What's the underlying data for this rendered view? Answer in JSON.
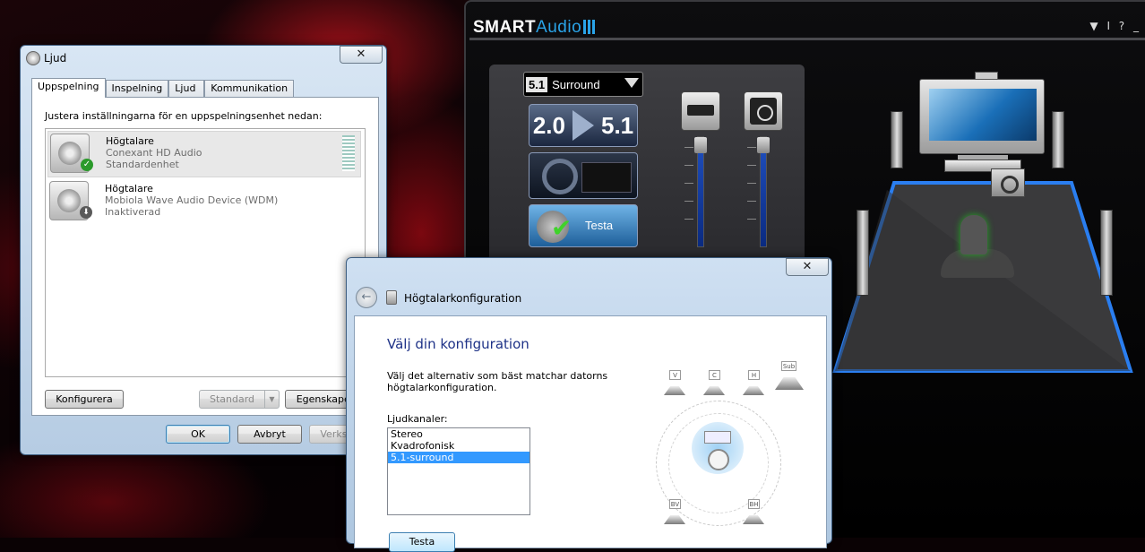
{
  "smart_audio": {
    "brand_smart": "SMART",
    "brand_audio": "Audio",
    "window_controls": "▼ I ? _",
    "mode_badge": "5.1",
    "mode_label": "Surround",
    "tile_from": "2.0",
    "tile_to": "5.1",
    "test_label": "Testa"
  },
  "ljud": {
    "title": "Ljud",
    "close": "✕",
    "tabs": [
      "Uppspelning",
      "Inspelning",
      "Ljud",
      "Kommunikation"
    ],
    "instruction": "Justera inställningarna för en uppspelningsenhet nedan:",
    "devices": [
      {
        "name": "Högtalare",
        "line2": "Conexant HD Audio",
        "line3": "Standardenhet",
        "status": "✓"
      },
      {
        "name": "Högtalare",
        "line2": "Mobiola Wave Audio Device (WDM)",
        "line3": "Inaktiverad",
        "status": "⬇"
      }
    ],
    "configure_label": "Konfigurera",
    "standard_label": "Standard",
    "properties_label": "Egenskaper",
    "ok_label": "OK",
    "cancel_label": "Avbryt",
    "apply_label": "Verkställ"
  },
  "wizard": {
    "back": "←",
    "title": "Högtalarkonfiguration",
    "close": "✕",
    "heading": "Välj din konfiguration",
    "description": "Välj det alternativ som bäst matchar datorns högtalarkonfiguration.",
    "channels_label": "Ljudkanaler:",
    "channels": [
      "Stereo",
      "Kvadrofonisk",
      "5.1-surround"
    ],
    "selected_channel": "5.1-surround",
    "test_label": "Testa",
    "speaker_tags": [
      "V",
      "C",
      "H",
      "Sub",
      "BV",
      "BH"
    ]
  }
}
